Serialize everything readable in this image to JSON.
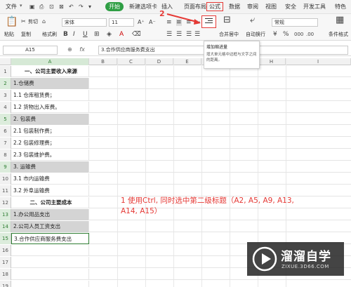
{
  "menu": {
    "file": "文件",
    "start": "开始",
    "tabs": [
      "新建选项卡",
      "插入",
      "页面布局",
      "公式",
      "数据",
      "审阅",
      "视图",
      "安全",
      "开发工具",
      "特色"
    ]
  },
  "ribbon": {
    "paste": "粘贴",
    "cut": "剪切",
    "copy": "复制",
    "format_painter": "格式刷",
    "font_name": "宋体",
    "font_size": "11",
    "merge_center": "合并居中",
    "wrap_text": "自动换行",
    "number_format": "常规",
    "conditional_format": "条件格式"
  },
  "tooltip": {
    "title": "增加缩进量",
    "desc": "增大单元格中边框与文字之间的距离。"
  },
  "formula_bar": {
    "cell_ref": "A15",
    "fx": "fx",
    "content": "3.合作供应商服务费支出"
  },
  "columns": [
    "A",
    "B",
    "C",
    "D",
    "E",
    "F",
    "G",
    "H",
    "I"
  ],
  "rows": [
    {
      "num": "1",
      "text": "一、公司主要收入来源",
      "style": "title"
    },
    {
      "num": "2",
      "text": "1.仓储费",
      "style": "hl"
    },
    {
      "num": "3",
      "text": "1.1 仓库租赁费；",
      "style": ""
    },
    {
      "num": "4",
      "text": "1.2 货物出入库费。",
      "style": ""
    },
    {
      "num": "5",
      "text": "2. 包装费",
      "style": "hl"
    },
    {
      "num": "6",
      "text": "2.1 包装制作费；",
      "style": ""
    },
    {
      "num": "7",
      "text": "2.2 包装修理费；",
      "style": ""
    },
    {
      "num": "8",
      "text": "2.3 包装维护费。",
      "style": ""
    },
    {
      "num": "9",
      "text": "3. 运输费",
      "style": "hl"
    },
    {
      "num": "10",
      "text": "3.1 市内运输费",
      "style": ""
    },
    {
      "num": "11",
      "text": "3.2 外阜运输费",
      "style": ""
    },
    {
      "num": "12",
      "text": "二、公司主要成本",
      "style": "title"
    },
    {
      "num": "13",
      "text": "1.办公用品支出",
      "style": "hl"
    },
    {
      "num": "14",
      "text": "2.公司人员工资支出",
      "style": "hl"
    },
    {
      "num": "15",
      "text": "3.合作供应商服务费支出",
      "style": "active"
    },
    {
      "num": "16",
      "text": "",
      "style": ""
    },
    {
      "num": "17",
      "text": "",
      "style": ""
    },
    {
      "num": "18",
      "text": "",
      "style": ""
    },
    {
      "num": "19",
      "text": "",
      "style": ""
    }
  ],
  "annotation": {
    "step2": "2",
    "line1": "1 使用Ctrl, 同时选中第二级标题（A2, A5, A9, A13,",
    "line2": "A14, A15）"
  },
  "watermark": {
    "title": "溜溜自学",
    "subtitle": "ZIXUE.3D66.COM"
  },
  "colors": {
    "accent_green": "#2f9e44",
    "annotation_red": "#e53935",
    "selection_gray": "#d4d4d4"
  }
}
